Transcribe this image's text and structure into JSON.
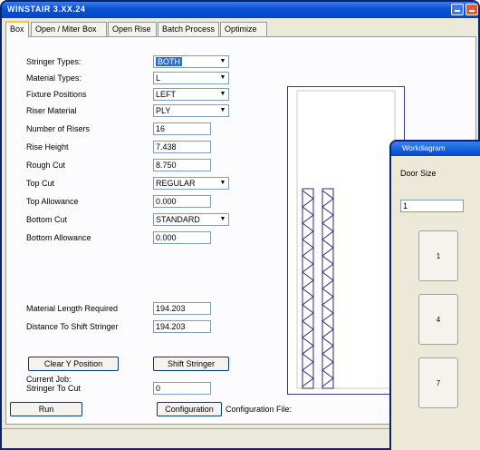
{
  "window": {
    "title": "WINSTAIR 3.XX.24"
  },
  "tabs": [
    {
      "label": "Box"
    },
    {
      "label": "Open / Miter Box"
    },
    {
      "label": "Open Rise"
    },
    {
      "label": "Batch Process"
    },
    {
      "label": "Optimize"
    }
  ],
  "form": {
    "stringer_types": {
      "label": "Stringer Types:",
      "value": "BOTH"
    },
    "material_types": {
      "label": "Material Types:",
      "value": "L"
    },
    "fixture_positions": {
      "label": "Fixture Positions",
      "value": "LEFT"
    },
    "riser_material": {
      "label": "Riser Material",
      "value": "PLY"
    },
    "number_of_risers": {
      "label": "Number of Risers",
      "value": "16"
    },
    "rise_height": {
      "label": "Rise Height",
      "value": "7.438"
    },
    "rough_cut": {
      "label": "Rough Cut",
      "value": "8.750"
    },
    "top_cut": {
      "label": "Top Cut",
      "value": "REGULAR"
    },
    "top_allowance": {
      "label": "Top Allowance",
      "value": "0.000"
    },
    "bottom_cut": {
      "label": "Bottom Cut",
      "value": "STANDARD"
    },
    "bottom_allowance": {
      "label": "Bottom Allowance",
      "value": "0.000"
    },
    "material_length_required": {
      "label": "Material Length Required",
      "value": "194.203"
    },
    "distance_to_shift_stringer": {
      "label": "Distance To Shift Stringer",
      "value": "194.203"
    },
    "current_job": {
      "label": "Current Job:\nStringer To Cut",
      "value": "0"
    }
  },
  "buttons": {
    "clear_y_position": "Clear Y Position",
    "shift_stringer": "Shift Stringer",
    "run": "Run",
    "configuration": "Configuration"
  },
  "status": {
    "config_file_label": "Configuration File:"
  },
  "numpad": {
    "title": "Workdiagram",
    "field_label": "Door Size",
    "field_value": "1",
    "keys": [
      "1",
      "4",
      "7"
    ]
  }
}
